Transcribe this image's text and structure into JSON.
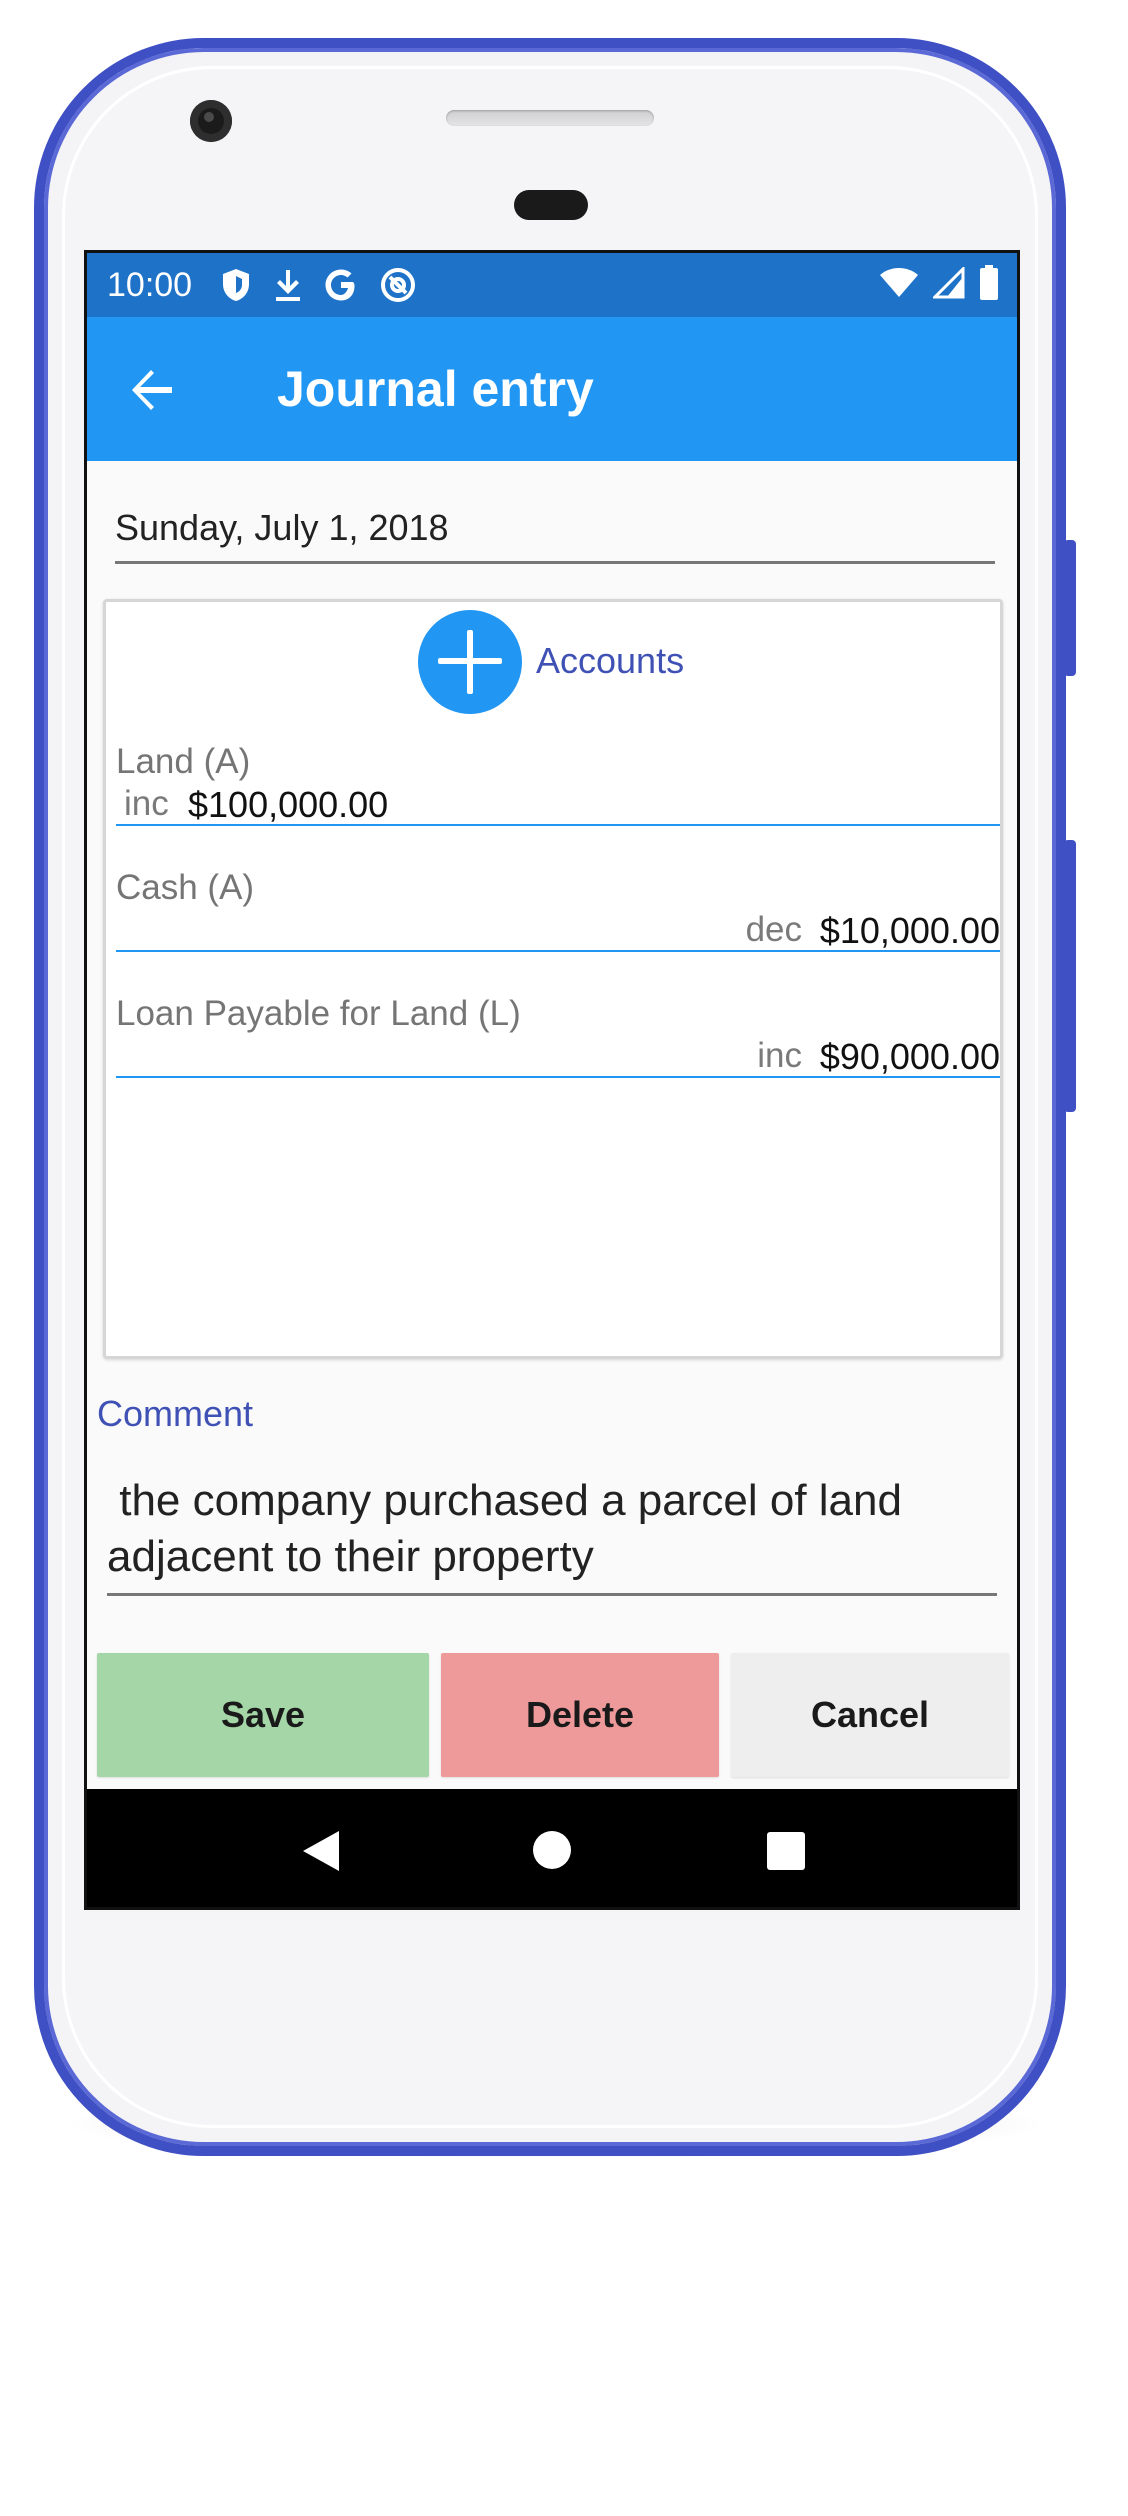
{
  "statusbar": {
    "time": "10:00",
    "left_icons": [
      "shield-icon",
      "download-icon",
      "google-icon",
      "at-sign-icon"
    ],
    "right_icons": [
      "wifi-icon",
      "signal-icon",
      "battery-icon"
    ]
  },
  "appbar": {
    "title": "Journal entry",
    "back_icon": "arrow-left-icon"
  },
  "date_field": {
    "value": "Sunday, July 1, 2018"
  },
  "accounts": {
    "add_label": "Accounts",
    "entries": [
      {
        "name": "Land (A)",
        "direction": "inc",
        "amount": "$100,000.00"
      },
      {
        "name": "Cash (A)",
        "direction": "dec",
        "amount": "$10,000.00"
      },
      {
        "name": "Loan Payable for Land (L)",
        "direction": "inc",
        "amount": "$90,000.00"
      }
    ]
  },
  "comment": {
    "label": "Comment",
    "value": " the company purchased a parcel of land\nadjacent to their property"
  },
  "buttons": {
    "save": "Save",
    "delete": "Delete",
    "cancel": "Cancel"
  },
  "colors": {
    "statusbar": "#1e73c9",
    "appbar": "#2196f3",
    "accent": "#3f51b5",
    "save": "#a5d6a7",
    "delete": "#ef9a9a",
    "cancel": "#eeeeee",
    "phone_frame": "#3f4fc4"
  }
}
